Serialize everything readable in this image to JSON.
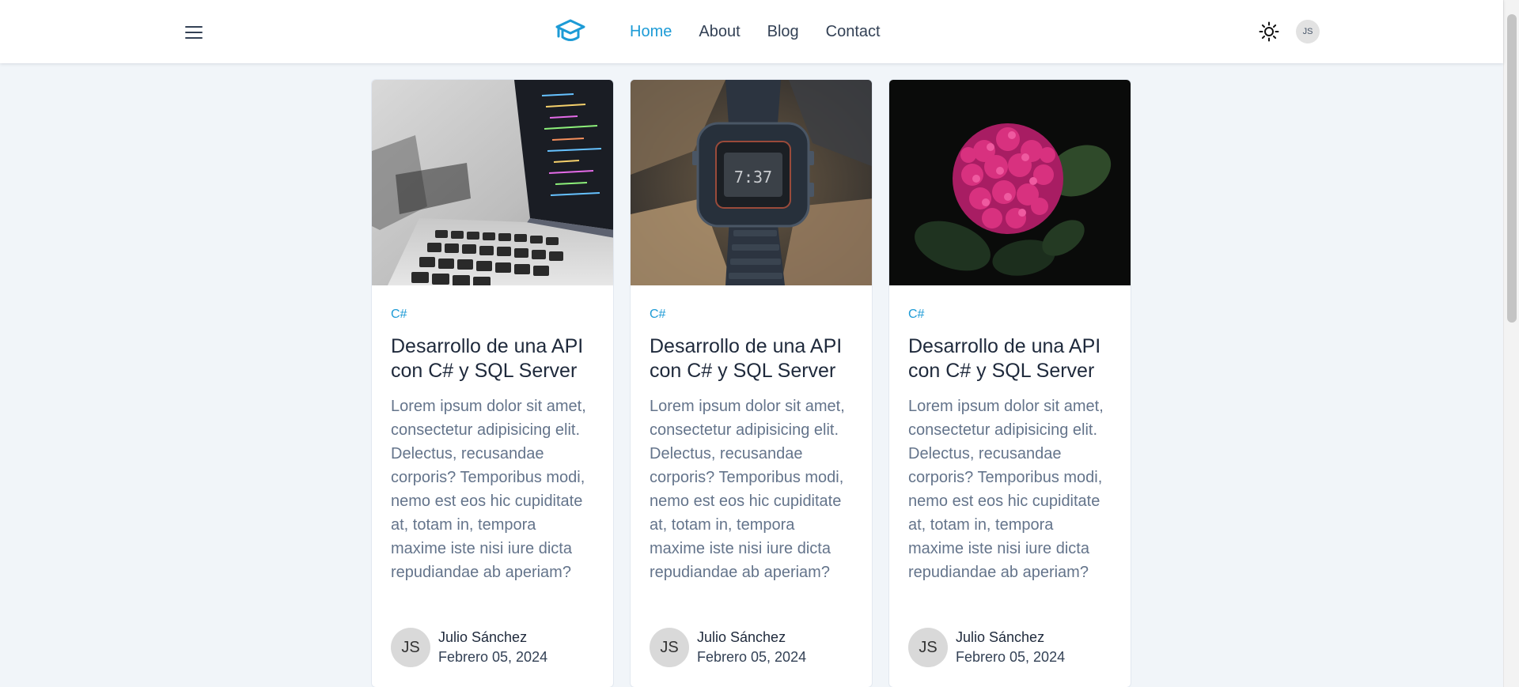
{
  "header": {
    "menu_icon": "hamburger-menu-icon",
    "logo_icon": "graduation-cap-icon",
    "nav": [
      {
        "label": "Home",
        "active": true
      },
      {
        "label": "About",
        "active": false
      },
      {
        "label": "Blog",
        "active": false
      },
      {
        "label": "Contact",
        "active": false
      }
    ],
    "theme_icon": "sun-icon",
    "avatar_initials": "JS"
  },
  "colors": {
    "accent": "#1d9bd6",
    "background": "#f1f5f9",
    "card": "#ffffff"
  },
  "posts": [
    {
      "image": "laptop-code-photo",
      "tag": "C#",
      "title": "Desarrollo de una API con C# y SQL Server",
      "excerpt": "Lorem ipsum dolor sit amet, consectetur adipisicing elit. Delectus, recusandae corporis? Temporibus modi, nemo est eos hic cupiditate at, totam in, tempora maxime iste nisi iure dicta repudiandae ab aperiam?",
      "author": {
        "initials": "JS",
        "name": "Julio Sánchez",
        "date": "Febrero 05, 2024"
      }
    },
    {
      "image": "wristwatch-photo",
      "tag": "C#",
      "title": "Desarrollo de una API con C# y SQL Server",
      "excerpt": "Lorem ipsum dolor sit amet, consectetur adipisicing elit. Delectus, recusandae corporis? Temporibus modi, nemo est eos hic cupiditate at, totam in, tempora maxime iste nisi iure dicta repudiandae ab aperiam?",
      "author": {
        "initials": "JS",
        "name": "Julio Sánchez",
        "date": "Febrero 05, 2024"
      }
    },
    {
      "image": "pink-hydrangea-photo",
      "tag": "C#",
      "title": "Desarrollo de una API con C# y SQL Server",
      "excerpt": "Lorem ipsum dolor sit amet, consectetur adipisicing elit. Delectus, recusandae corporis? Temporibus modi, nemo est eos hic cupiditate at, totam in, tempora maxime iste nisi iure dicta repudiandae ab aperiam?",
      "author": {
        "initials": "JS",
        "name": "Julio Sánchez",
        "date": "Febrero 05, 2024"
      }
    }
  ]
}
